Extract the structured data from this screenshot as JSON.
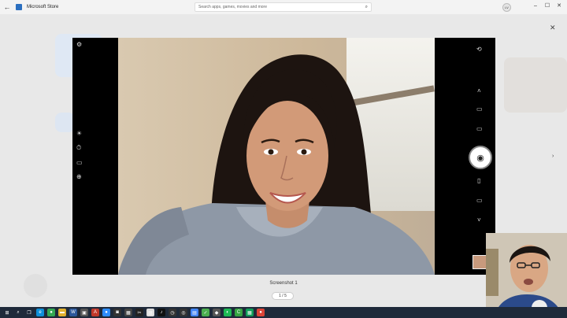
{
  "app": {
    "title": "Microsoft Store",
    "back_glyph": "←"
  },
  "search": {
    "placeholder": "Search apps, games, movies and more"
  },
  "account": {
    "initials": "LV"
  },
  "window_controls": {
    "minimize": "–",
    "maximize": "☐",
    "close": "✕"
  },
  "overlay": {
    "close": "✕",
    "next": "›"
  },
  "viewer": {
    "left_tools": [
      {
        "name": "settings-icon",
        "glyph": "⚙"
      },
      {
        "name": "brightness-icon",
        "glyph": "☀"
      },
      {
        "name": "timer-icon",
        "glyph": "⏱"
      },
      {
        "name": "aspect-icon",
        "glyph": "▭"
      },
      {
        "name": "zoom-icon",
        "glyph": "⊕"
      }
    ],
    "right_tools": [
      {
        "name": "switch-camera-icon",
        "glyph": "⟲"
      },
      {
        "name": "chevron-up-icon",
        "glyph": "˄"
      },
      {
        "name": "panorama-icon",
        "glyph": "▭"
      },
      {
        "name": "video-icon",
        "glyph": "▭"
      },
      {
        "name": "document-icon",
        "glyph": "▯"
      },
      {
        "name": "whiteboard-icon",
        "glyph": "▭"
      },
      {
        "name": "chevron-down-icon",
        "glyph": "˅"
      }
    ],
    "shutter_glyph": "◉"
  },
  "caption": "Screenshot 1",
  "pager": "1 / 5",
  "colors": {
    "accent": "#2b6fc0",
    "taskbar": "#1f2a3a"
  },
  "taskbar": [
    {
      "name": "start-icon",
      "glyph": "⊞",
      "color": "#1f2a3a"
    },
    {
      "name": "search-taskbar-icon",
      "glyph": "⌕",
      "color": "#1f2a3a"
    },
    {
      "name": "taskview-icon",
      "glyph": "❐",
      "color": "#1f2a3a"
    },
    {
      "name": "edge-icon",
      "glyph": "e",
      "color": "#0e8fd8"
    },
    {
      "name": "chrome-icon",
      "glyph": "●",
      "color": "#34a853"
    },
    {
      "name": "explorer-icon",
      "glyph": "▬",
      "color": "#e0b030"
    },
    {
      "name": "word-icon",
      "glyph": "W",
      "color": "#2b579a"
    },
    {
      "name": "app-icon",
      "glyph": "▣",
      "color": "#555"
    },
    {
      "name": "pdf-icon",
      "glyph": "A",
      "color": "#c0392b"
    },
    {
      "name": "zoom-app-icon",
      "glyph": "●",
      "color": "#2d8cff"
    },
    {
      "name": "camera-app-icon",
      "glyph": "◙",
      "color": "#333"
    },
    {
      "name": "store-icon",
      "glyph": "▦",
      "color": "#444"
    },
    {
      "name": "capcut-icon",
      "glyph": "✂",
      "color": "#222"
    },
    {
      "name": "notes-icon",
      "glyph": "▤",
      "color": "#ddd"
    },
    {
      "name": "tiktok-icon",
      "glyph": "♪",
      "color": "#111"
    },
    {
      "name": "clock-icon",
      "glyph": "◷",
      "color": "#333"
    },
    {
      "name": "obs-icon",
      "glyph": "◎",
      "color": "#333"
    },
    {
      "name": "docs-icon",
      "glyph": "▤",
      "color": "#4285f4"
    },
    {
      "name": "tasks-icon",
      "glyph": "✓",
      "color": "#4caf50"
    },
    {
      "name": "games-icon",
      "glyph": "◆",
      "color": "#555"
    },
    {
      "name": "media-icon",
      "glyph": "◐",
      "color": "#1db954"
    },
    {
      "name": "camtasia-icon",
      "glyph": "C",
      "color": "#36a543"
    },
    {
      "name": "sheets-icon",
      "glyph": "▦",
      "color": "#0f9d58"
    },
    {
      "name": "chrome2-icon",
      "glyph": "●",
      "color": "#db4437"
    }
  ]
}
